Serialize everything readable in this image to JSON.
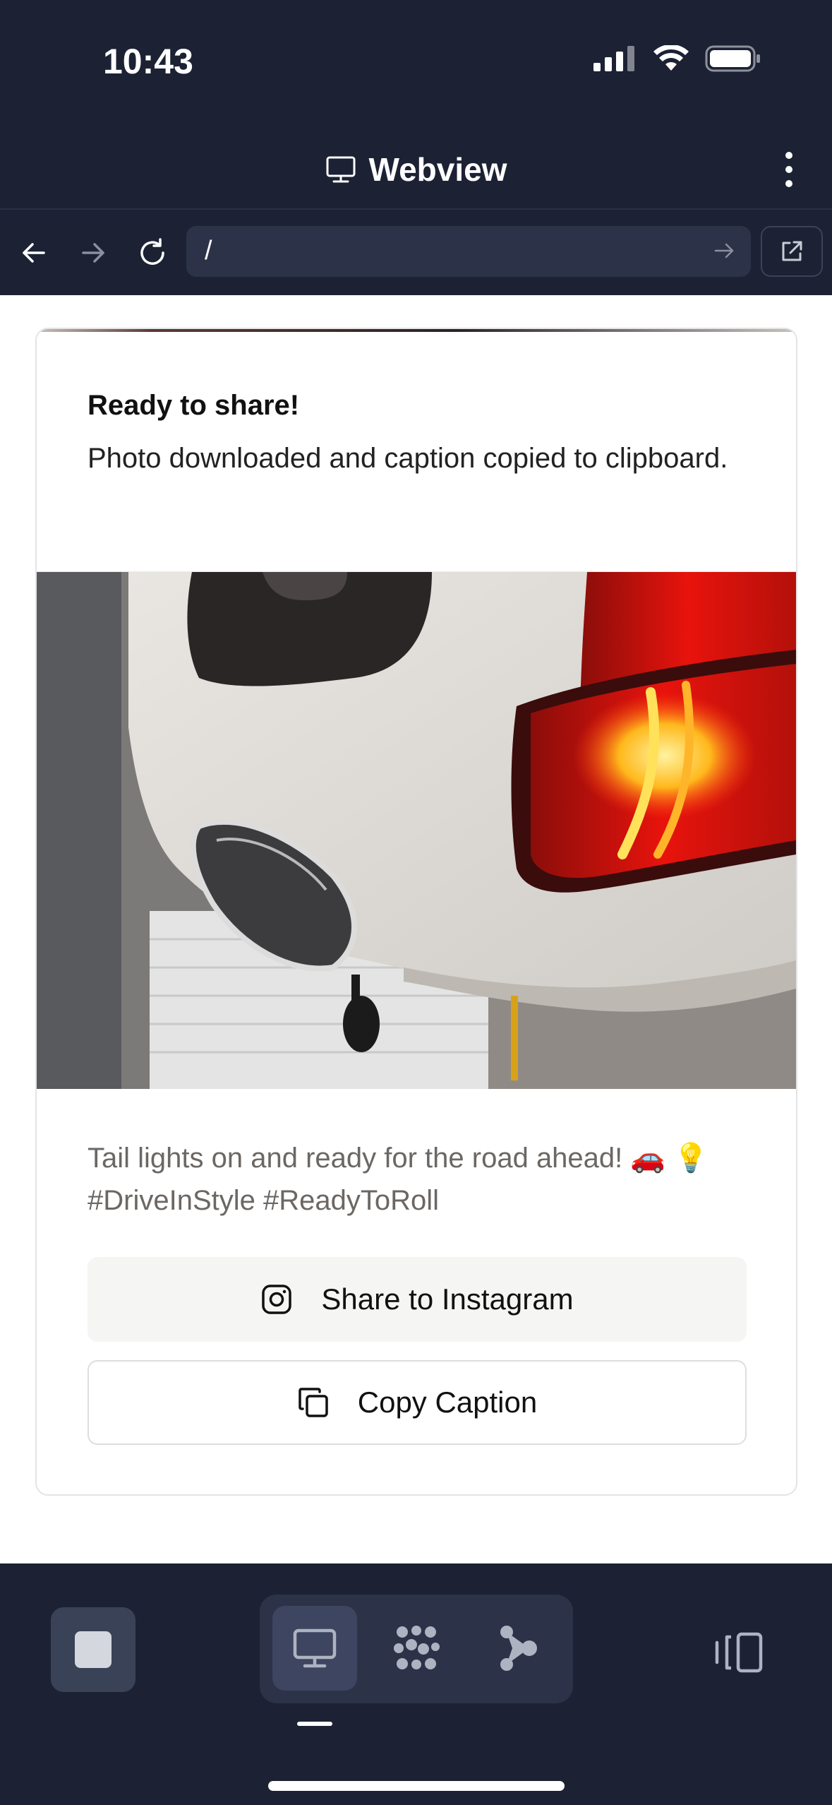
{
  "status_bar": {
    "time": "10:43"
  },
  "title_bar": {
    "title": "Webview",
    "title_icon": "monitor-icon",
    "menu_icon": "more-vertical-icon"
  },
  "nav": {
    "back_icon": "arrow-left-icon",
    "forward_icon": "arrow-right-icon",
    "reload_icon": "reload-icon",
    "url": "/",
    "go_icon": "arrow-right-icon",
    "external_icon": "external-link-icon"
  },
  "toast": {
    "title": "Ready to share!",
    "body": "Photo downloaded and caption copied to clipboard."
  },
  "post": {
    "photo_desc_icon": "car-tail-light-photo",
    "caption": "Tail lights on and ready for the road ahead! 🚗 💡 #DriveInStyle #ReadyToRoll",
    "share_label": "Share to Instagram",
    "copy_label": "Copy Caption"
  },
  "bottom_bar": {
    "stop_icon": "stop-icon",
    "modes": [
      "monitor-icon",
      "grid-dots-icon",
      "branch-icon"
    ],
    "active_mode": 0,
    "layout_icon": "layout-panel-icon"
  },
  "colors": {
    "chrome_bg": "#1c2234",
    "url_bg": "#2c3348",
    "card_border": "#e4e4e7",
    "caption_text": "#6b6764",
    "tail_light_red": "#e8130c"
  }
}
